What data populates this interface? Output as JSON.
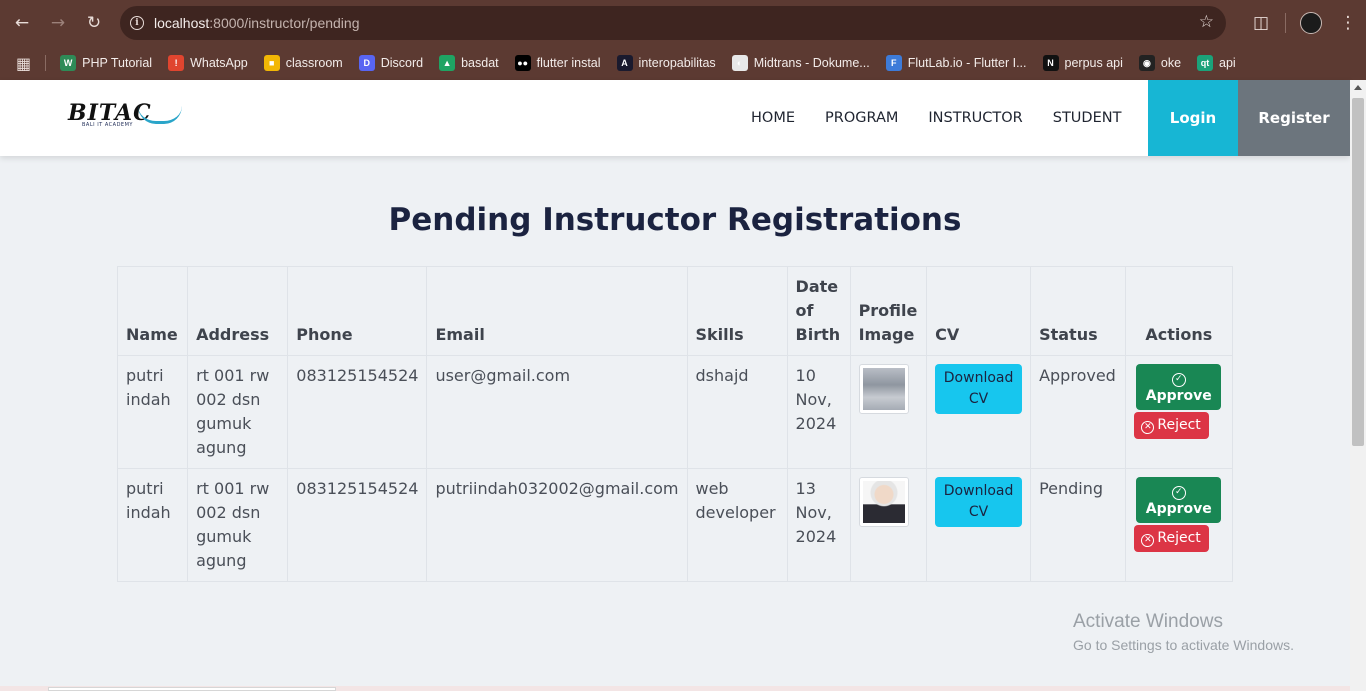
{
  "browser": {
    "url_host": "localhost",
    "url_path": ":8000/instructor/pending",
    "bookmarks": [
      {
        "label": "PHP Tutorial",
        "color": "#2e8b57",
        "glyph": "W"
      },
      {
        "label": "WhatsApp",
        "color": "#e0452f",
        "glyph": "!"
      },
      {
        "label": "classroom",
        "color": "#f2b705",
        "glyph": "■"
      },
      {
        "label": "Discord",
        "color": "#5865f2",
        "glyph": "D"
      },
      {
        "label": "basdat",
        "color": "#1fa463",
        "glyph": "▲"
      },
      {
        "label": "flutter instal",
        "color": "#000000",
        "glyph": "●●"
      },
      {
        "label": "interopabilitas",
        "color": "#1a1a2e",
        "glyph": "A"
      },
      {
        "label": "Midtrans - Dokume...",
        "color": "#e8e8e8",
        "glyph": "◐"
      },
      {
        "label": "FlutLab.io - Flutter I...",
        "color": "#3d7bd9",
        "glyph": "F"
      },
      {
        "label": "perpus api",
        "color": "#111111",
        "glyph": "N"
      },
      {
        "label": "oke",
        "color": "#222222",
        "glyph": "◉"
      },
      {
        "label": "api",
        "color": "#1aa37a",
        "glyph": "qt"
      }
    ]
  },
  "site": {
    "logo_text": "BITAC",
    "logo_sub": "BALI IT ACADEMY",
    "nav": [
      "HOME",
      "PROGRAM",
      "INSTRUCTOR",
      "STUDENT"
    ],
    "login": "Login",
    "register": "Register"
  },
  "page": {
    "title": "Pending Instructor Registrations",
    "columns": [
      "Name",
      "Address",
      "Phone",
      "Email",
      "Skills",
      "Date of Birth",
      "Profile Image",
      "CV",
      "Status",
      "Actions"
    ],
    "rows": [
      {
        "name": "putri indah",
        "address": "rt 001 rw 002 dsn gumuk agung",
        "phone": "083125154524",
        "email": "user@gmail.com",
        "skills": "dshajd",
        "dob": "10 Nov, 2024",
        "image": "document-scan",
        "cv_label": "Download CV",
        "status": "Approved",
        "approve_label": "Approve",
        "reject_label": "Reject"
      },
      {
        "name": "putri indah",
        "address": "rt 001 rw 002 dsn gumuk agung",
        "phone": "083125154524",
        "email": "putriindah032002@gmail.com",
        "skills": "web developer",
        "dob": "13 Nov, 2024",
        "image": "portrait-photo",
        "cv_label": "Download CV",
        "status": "Pending",
        "approve_label": "Approve",
        "reject_label": "Reject"
      }
    ]
  },
  "watermark": {
    "line1": "Activate Windows",
    "line2": "Go to Settings to activate Windows."
  },
  "colors": {
    "login_bg": "#17b6d4",
    "register_bg": "#6c757d",
    "approve_bg": "#198754",
    "reject_bg": "#dc3545",
    "cv_bg": "#17c6ee"
  }
}
